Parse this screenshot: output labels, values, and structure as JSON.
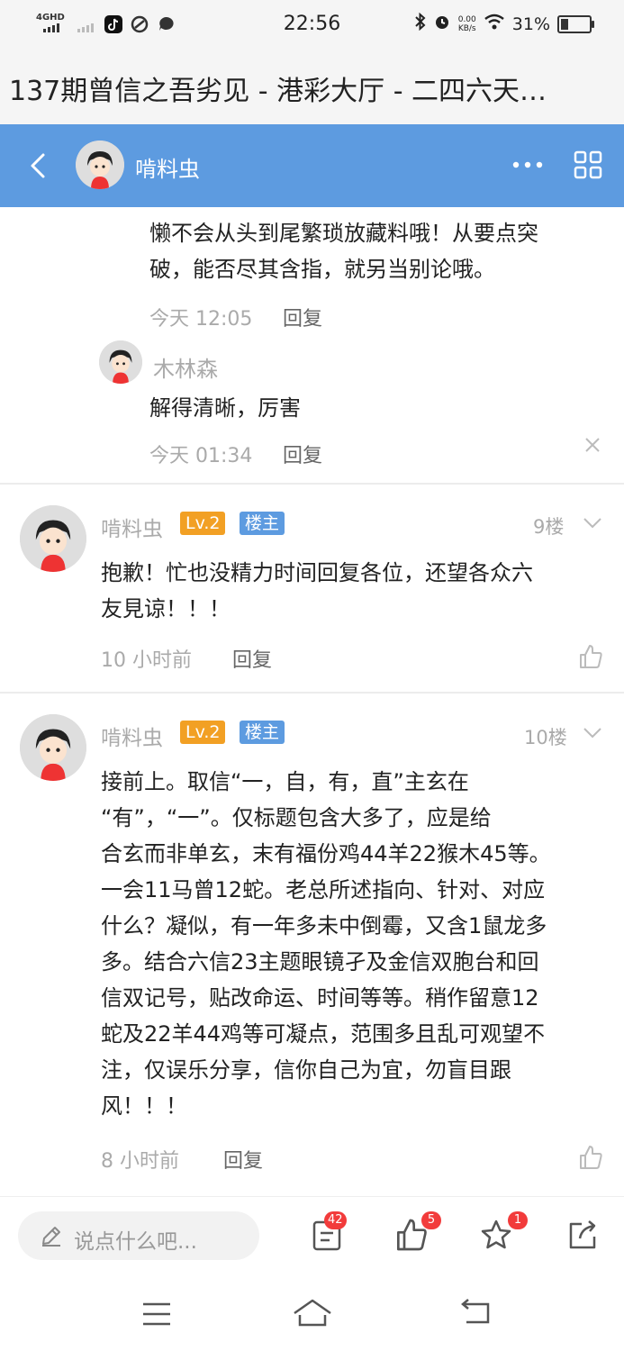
{
  "status": {
    "network": "4GHD",
    "time": "22:56",
    "speed_top": "0.00",
    "speed_unit": "KB/s",
    "battery": "31%",
    "battery_level": 0.31
  },
  "page_title": "137期曾信之吾劣见 - 港彩大厅 - 二四六天…",
  "header": {
    "name": "啃料虫"
  },
  "thread": {
    "partial_lines": [
      "懒不会从头到尾繁琐放藏料哦！从要点突",
      "破，能否尽其含指，就另当别论哦。"
    ],
    "partial_time": "今天 12:05",
    "reply_label": "回复",
    "sub_reply": {
      "user": "木林森",
      "text": "解得清晰，厉害",
      "time": "今天 01:34",
      "reply_label": "回复"
    }
  },
  "posts": [
    {
      "user": "啃料虫",
      "level": "Lv.2",
      "role": "楼主",
      "floor": "9楼",
      "lines": [
        "抱歉！忙也没精力时间回复各位，还望各众六",
        "友見谅！！！"
      ],
      "time": "10 小时前",
      "reply_label": "回复"
    },
    {
      "user": "啃料虫",
      "level": "Lv.2",
      "role": "楼主",
      "floor": "10楼",
      "lines": [
        "接前上。取信“一，自，有，直”主玄在",
        "“有”，“一”。仅标题包含大多了，应是给",
        "合玄而非单玄，末有福份鸡44羊22猴木45等。",
        "一会11马曾12蛇。老总所述指向、针对、对应",
        "什么？凝似，有一年多未中倒霉，又含1鼠龙多",
        "多。结合六信23主题眼镜孑及金信双胞台和回",
        "信双记号，贴改命运、时间等等。稍作留意12",
        "蛇及22羊44鸡等可凝点，范围多且乱可观望不",
        "注，仅误乐分享，信你自己为宜，勿盲目跟",
        "风！！！"
      ],
      "time": "8 小时前",
      "reply_label": "回复"
    }
  ],
  "bottom": {
    "placeholder": "说点什么吧...",
    "comments_count": "42",
    "likes_count": "5",
    "favorites_count": "1"
  }
}
